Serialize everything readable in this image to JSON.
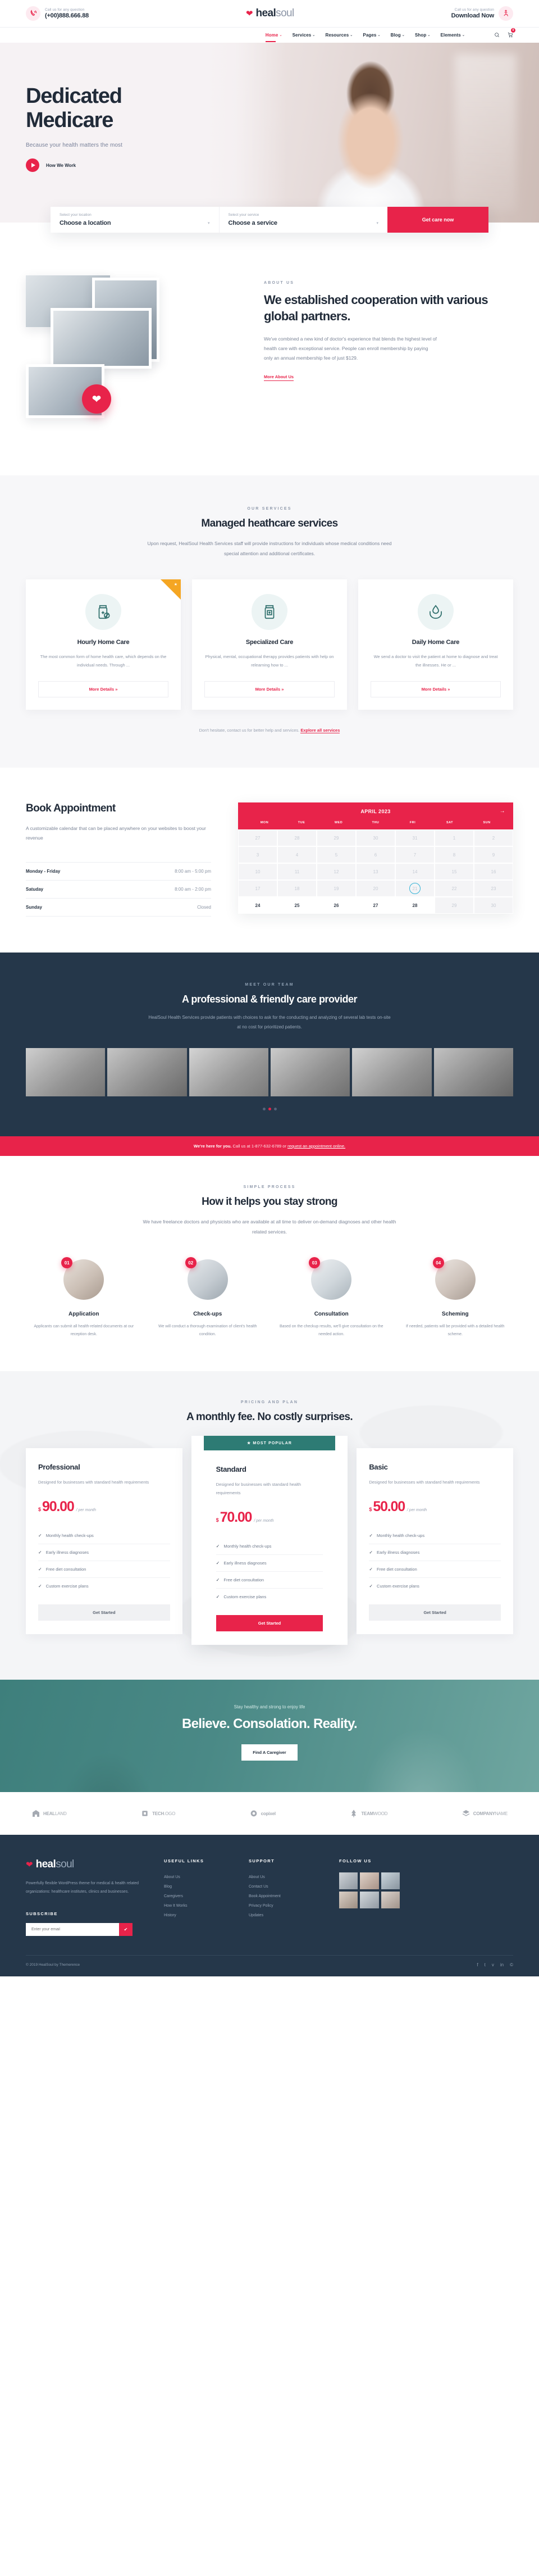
{
  "topbar": {
    "left": {
      "icon": "phone-ring-icon",
      "label": "Call us for any question",
      "value": "(+00)888.666.88"
    },
    "logo": {
      "icon": "heart-icon",
      "bold": "heal",
      "light": "soul"
    },
    "right": {
      "icon": "accessibility-icon",
      "label": "Call us for any question",
      "value": "Download Now"
    }
  },
  "nav": {
    "items": [
      {
        "label": "Home",
        "caret": "⌄",
        "active": true
      },
      {
        "label": "Services",
        "caret": "⌄",
        "active": false
      },
      {
        "label": "Resources",
        "caret": "⌄",
        "active": false
      },
      {
        "label": "Pages",
        "caret": "⌄",
        "active": false
      },
      {
        "label": "Blog",
        "caret": "⌄",
        "active": false
      },
      {
        "label": "Shop",
        "caret": "⌄",
        "active": false
      },
      {
        "label": "Elements",
        "caret": "⌄",
        "active": false
      }
    ],
    "tools": {
      "search": "search-icon",
      "cart": "cart-icon",
      "cart_count": "0"
    }
  },
  "hero": {
    "title_line1": "Dedicated",
    "title_line2": "Medicare",
    "subtitle": "Because your health matters the most",
    "play_label": "How We Work"
  },
  "search": {
    "location_label": "Select your location",
    "location_value": "Choose a location",
    "service_label": "Select your service",
    "service_value": "Choose a service",
    "button": "Get care now"
  },
  "about": {
    "eyebrow": "ABOUT US",
    "heading": "We established cooperation with various global partners.",
    "paragraph": "We've combined a new kind of doctor's experience that blends the highest level of health care with exceptional service. People can enroll membership by paying only an annual membership fee of just $129.",
    "link": "More About Us",
    "badge_icon": "heart-icon"
  },
  "services": {
    "eyebrow": "OUR SERVICES",
    "heading": "Managed heathcare services",
    "subtext": "Upon request, HealSoul Health Services staff will provide instructions for individuals whose medical conditions need special attention and additional certificates.",
    "cards": [
      {
        "icon": "medicine-bottle-pill-icon",
        "title": "Hourly Home Care",
        "text": "The most common form of home health care, which depends on the individual needs. Through ...",
        "button": "More Details  »",
        "featured": true
      },
      {
        "icon": "medicine-bottle-cross-icon",
        "title": "Specialized Care",
        "text": "Physical, mental, occupational therapy provides patients with help on relearning how to ...",
        "button": "More Details  »",
        "featured": false
      },
      {
        "icon": "hands-drop-icon",
        "title": "Daily Home Care",
        "text": "We send a doctor to visit the patient at home to diagnose and treat the illnesses. He or ...",
        "button": "More Details  »",
        "featured": false
      }
    ],
    "note_text": "Don't hesitate, contact us for better help and services.",
    "note_link": "Explore all services"
  },
  "appointment": {
    "heading": "Book Appointment",
    "lead": "A customizable calendar that can be placed anywhere on your websites to boost your revenue",
    "hours": [
      {
        "day": "Monday - Friday",
        "time": "8:00 am - 5:00 pm"
      },
      {
        "day": "Satuday",
        "time": "8:00 am - 2:00 pm"
      },
      {
        "day": "Sunday",
        "time": "Closed"
      }
    ],
    "calendar": {
      "title": "APRIL 2023",
      "next_icon": "arrow-right-icon",
      "dows": [
        "MON",
        "TUE",
        "WED",
        "THU",
        "FRI",
        "SAT",
        "SUN"
      ],
      "weeks": [
        [
          {
            "d": "27",
            "s": "out"
          },
          {
            "d": "28",
            "s": "out"
          },
          {
            "d": "29",
            "s": "out"
          },
          {
            "d": "30",
            "s": "out"
          },
          {
            "d": "31",
            "s": "out"
          },
          {
            "d": "1",
            "s": "out"
          },
          {
            "d": "2",
            "s": "out"
          }
        ],
        [
          {
            "d": "3",
            "s": "out"
          },
          {
            "d": "4",
            "s": "out"
          },
          {
            "d": "5",
            "s": "out"
          },
          {
            "d": "6",
            "s": "out"
          },
          {
            "d": "7",
            "s": "out"
          },
          {
            "d": "8",
            "s": "out"
          },
          {
            "d": "9",
            "s": "out"
          }
        ],
        [
          {
            "d": "10",
            "s": "out"
          },
          {
            "d": "11",
            "s": "out"
          },
          {
            "d": "12",
            "s": "out"
          },
          {
            "d": "13",
            "s": "out"
          },
          {
            "d": "14",
            "s": "out"
          },
          {
            "d": "15",
            "s": "out"
          },
          {
            "d": "16",
            "s": "out"
          }
        ],
        [
          {
            "d": "17",
            "s": "out"
          },
          {
            "d": "18",
            "s": "out"
          },
          {
            "d": "19",
            "s": "out"
          },
          {
            "d": "20",
            "s": "out"
          },
          {
            "d": "21",
            "s": "sel"
          },
          {
            "d": "22",
            "s": "out"
          },
          {
            "d": "23",
            "s": "out"
          }
        ],
        [
          {
            "d": "24",
            "s": "avail"
          },
          {
            "d": "25",
            "s": "avail"
          },
          {
            "d": "26",
            "s": "avail"
          },
          {
            "d": "27",
            "s": "avail"
          },
          {
            "d": "28",
            "s": "avail"
          },
          {
            "d": "29",
            "s": "out"
          },
          {
            "d": "30",
            "s": "out"
          }
        ]
      ]
    }
  },
  "team": {
    "eyebrow": "MEET OUR TEAM",
    "heading": "A professional & friendly care provider",
    "text": "HealSoul Health Services provide patients with choices to ask for the conducting and analyzing of several lab tests on-site at no cost for prioritized patients.",
    "dots": 3,
    "active_dot": 1
  },
  "cta": {
    "bold": "We're here for you.",
    "rest": " Call us at 1-877-632-6789 or ",
    "link": "request an appointment online."
  },
  "process": {
    "eyebrow": "SIMPLE PROCESS",
    "heading": "How it helps you stay strong",
    "subtext": "We have freelance doctors and physicists who are available at all time to deliver on-demand diagnoses and other health related services.",
    "steps": [
      {
        "num": "01",
        "title": "Application",
        "text": "Applicants can submit all health-related documents at our reception desk."
      },
      {
        "num": "02",
        "title": "Check-ups",
        "text": "We will conduct a thorough examination of client's health condition."
      },
      {
        "num": "03",
        "title": "Consultation",
        "text": "Based on the checkup results, we'll give consultation on the needed action."
      },
      {
        "num": "04",
        "title": "Scheming",
        "text": "If needed, patients will be provided with a detailed health scheme."
      }
    ]
  },
  "pricing": {
    "eyebrow": "PRICING AND PLAN",
    "heading": "A monthly fee. No costly surprises.",
    "popular_tag": "MOST POPULAR",
    "popular_icon": "star-icon",
    "plans": [
      {
        "name": "Professional",
        "desc": "Designed for businesses with standard health requirements",
        "currency": "$",
        "amount": "90.00",
        "period": "/ per month",
        "features": [
          "Monthly health check-ups",
          "Early illness diagnoses",
          "Free diet consultation",
          "Custom exercise plans"
        ],
        "button": "Get Started",
        "popular": false
      },
      {
        "name": "Standard",
        "desc": "Designed for businesses with standard health requirements",
        "currency": "$",
        "amount": "70.00",
        "period": "/ per month",
        "features": [
          "Monthly health check-ups",
          "Early illness diagnoses",
          "Free diet consultation",
          "Custom exercise plans"
        ],
        "button": "Get Started",
        "popular": true
      },
      {
        "name": "Basic",
        "desc": "Designed for businesses with standard health requirements",
        "currency": "$",
        "amount": "50.00",
        "period": "/ per month",
        "features": [
          "Monthly health check-ups",
          "Early illness diagnoses",
          "Free diet consultation",
          "Custom exercise plans"
        ],
        "button": "Get Started",
        "popular": false
      }
    ]
  },
  "quote": {
    "subtitle": "Stay healthy and strong to enjoy life",
    "heading": "Believe. Consolation. Reality.",
    "button": "Find A Caregiver"
  },
  "brands": [
    {
      "icon": "building-icon",
      "bold": "HEAL",
      "light": "LAND"
    },
    {
      "icon": "tech-icon",
      "bold": "TECH",
      "light": ".OGO"
    },
    {
      "icon": "copixel-icon",
      "bold": "copixel",
      "light": ""
    },
    {
      "icon": "tree-icon",
      "bold": "TEAM",
      "light": "WOOD"
    },
    {
      "icon": "layers-icon",
      "bold": "COMPANY",
      "light": "NAME"
    }
  ],
  "footer": {
    "logo": {
      "bold": "heal",
      "light": "soul"
    },
    "about": "Powerfully flexible WordPress theme for medical & health related organizations: healthcare institutes, clinics and businesses.",
    "useful": {
      "title": "USEFUL LINKS",
      "items": [
        "About Us",
        "Blog",
        "Caregivers",
        "How It Works",
        "History"
      ]
    },
    "support": {
      "title": "SUPPORT",
      "items": [
        "About Us",
        "Contact Us",
        "Book Appointment",
        "Privacy Policy",
        "Updates"
      ]
    },
    "follow": {
      "title": "FOLLOW US"
    },
    "subscribe": {
      "title": "SUBSCRIBE",
      "placeholder": "Enter your email",
      "button": "✔"
    },
    "copyright": "© 2019 HealSoul by Themerence",
    "social": [
      "f",
      "t",
      "v",
      "in",
      "©"
    ]
  }
}
